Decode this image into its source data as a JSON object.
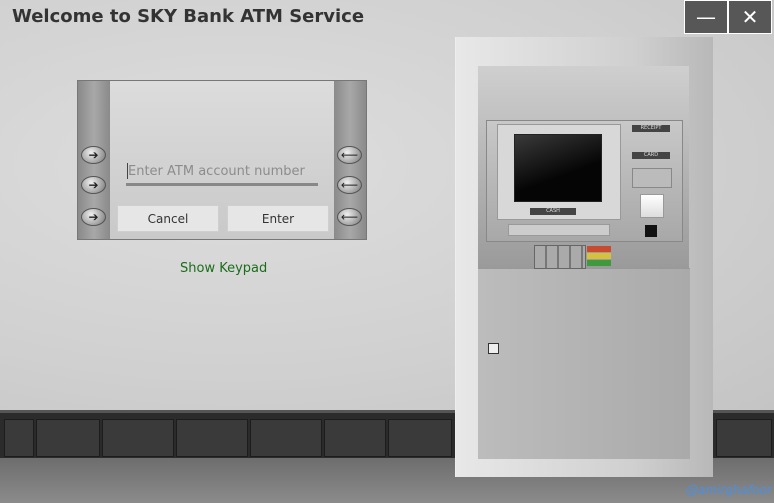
{
  "window": {
    "title": "Welcome to SKY Bank ATM Service",
    "minimize_glyph": "—",
    "close_glyph": "✕"
  },
  "panel": {
    "account_placeholder": "Enter ATM account number",
    "account_value": "",
    "cancel_label": "Cancel",
    "enter_label": "Enter",
    "left_button_glyph": "➔",
    "right_button_glyph": "⟵"
  },
  "keypad_link": "Show Keypad",
  "atm": {
    "receipt_label": "RECEIPT",
    "card_label": "CARD",
    "cash_label": "CASH"
  },
  "credit": "@amirghafoor",
  "colors": {
    "link": "#1a6d1a",
    "credit": "#4a90e2",
    "window_button": "#575757"
  }
}
